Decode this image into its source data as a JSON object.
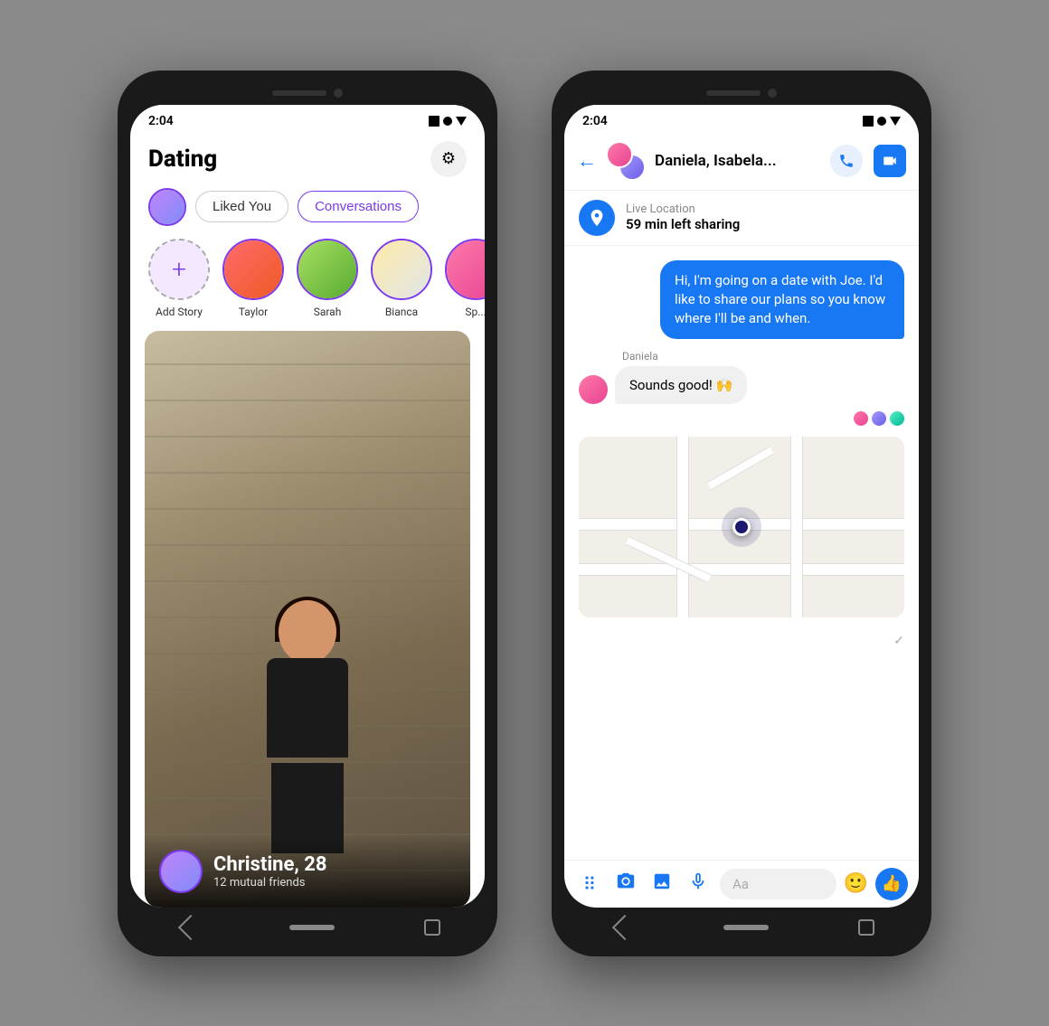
{
  "left_phone": {
    "status_time": "2:04",
    "title": "Dating",
    "tab_liked": "Liked You",
    "tab_conversations": "Conversations",
    "stories": [
      {
        "label": "Add Story",
        "type": "add"
      },
      {
        "label": "Taylor",
        "type": "person"
      },
      {
        "label": "Sarah",
        "type": "person"
      },
      {
        "label": "Bianca",
        "type": "person"
      },
      {
        "label": "Sp...",
        "type": "person"
      }
    ],
    "profile_name": "Christine, 28",
    "profile_mutual": "12 mutual friends"
  },
  "right_phone": {
    "status_time": "2:04",
    "header_name": "Daniela, Isabela...",
    "live_location_title": "Live Location",
    "live_location_subtitle": "59 min left sharing",
    "message_sent": "Hi, I'm going on a date with Joe. I'd like to share our plans so you know where I'll be and when.",
    "message_sender": "Daniela",
    "message_received": "Sounds good! 🙌",
    "input_placeholder": "Aa"
  }
}
